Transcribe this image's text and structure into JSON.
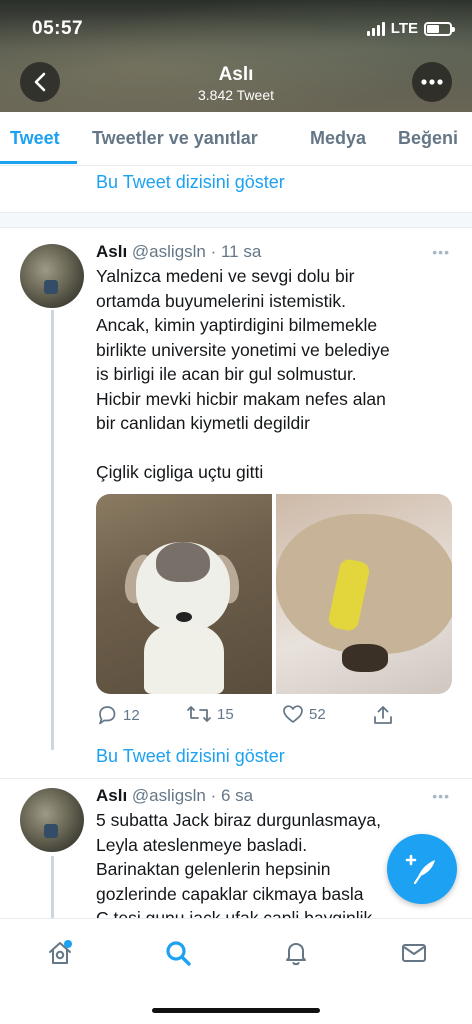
{
  "status_bar": {
    "time": "05:57",
    "network": "LTE"
  },
  "header": {
    "name": "Aslı",
    "tweet_count": "3.842 Tweet"
  },
  "tabs": [
    {
      "label": "Tweet",
      "active": true
    },
    {
      "label": "Tweetler ve yanıtlar",
      "active": false
    },
    {
      "label": "Medya",
      "active": false
    },
    {
      "label": "Beğeni",
      "active": false
    }
  ],
  "thread_link_top": "Bu Tweet dizisini göster",
  "tweets": [
    {
      "author": "Aslı",
      "handle": "@asligsln",
      "time": "· 11 sa",
      "text": "Yalnizca medeni ve sevgi dolu bir\nortamda buyumelerini istemistik.\nAncak, kimin yaptirdigini bilmemekle\nbirlikte universite yonetimi ve belediye\nis birligi ile acan bir gul solmustur.\nHicbir mevki hicbir makam nefes alan\nbir canlidan kiymetli degildir",
      "text2": "Çiglik cigliga uçtu gitti",
      "media": [
        "puppy-photo",
        "injured-puppy-photo"
      ],
      "replies": "12",
      "retweets": "15",
      "likes": "52"
    },
    {
      "author": "Aslı",
      "handle": "@asligsln",
      "time": "· 6 sa",
      "text": "5 subatta Jack biraz durgunlasmaya,\nLeyla ateslenmeye basladi.\nBarinaktan gelenlerin hepsinin\ngozlerinde capaklar cikmaya basla\nC.tesi gunu jack ufak capli bayginlik"
    }
  ],
  "thread_link_bottom": "Bu Tweet dizisini göster",
  "bottom_nav": [
    "home-icon",
    "search-icon",
    "notifications-icon",
    "messages-icon"
  ],
  "colors": {
    "accent": "#1da1f2",
    "secondary_text": "#657786"
  }
}
